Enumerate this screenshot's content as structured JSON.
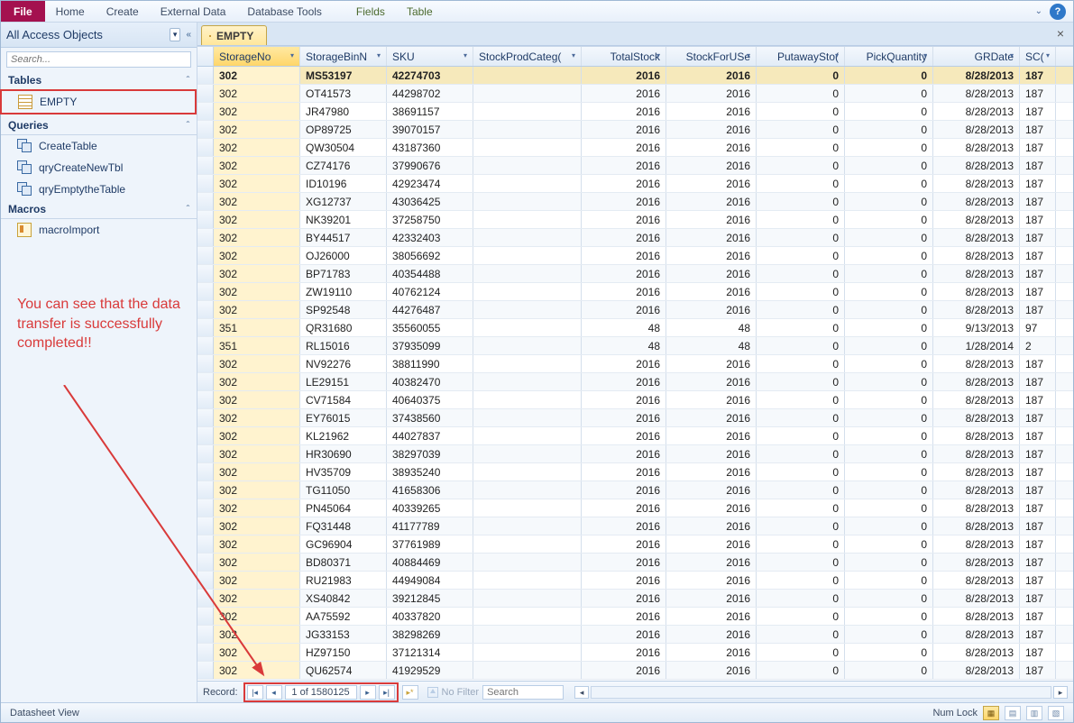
{
  "ribbon": {
    "file": "File",
    "tabs": [
      "Home",
      "Create",
      "External Data",
      "Database Tools"
    ],
    "ctx_tabs": [
      "Fields",
      "Table"
    ]
  },
  "nav": {
    "title": "All Access Objects",
    "search_placeholder": "Search...",
    "groups": [
      {
        "name": "Tables",
        "items": [
          {
            "label": "EMPTY",
            "icon": "table",
            "highlighted": true
          }
        ]
      },
      {
        "name": "Queries",
        "items": [
          {
            "label": "CreateTable",
            "icon": "query"
          },
          {
            "label": "qryCreateNewTbl",
            "icon": "query"
          },
          {
            "label": "qryEmptytheTable",
            "icon": "query"
          }
        ]
      },
      {
        "name": "Macros",
        "items": [
          {
            "label": "macroImport",
            "icon": "macro"
          }
        ]
      }
    ]
  },
  "annotation": {
    "text": "You can see that the data transfer is successfully completed!!"
  },
  "doc_tab": {
    "label": "EMPTY"
  },
  "columns": [
    {
      "key": "StorageNo",
      "label": "StorageNo",
      "cls": "c-sn",
      "sel": true
    },
    {
      "key": "StorageBinN",
      "label": "StorageBinN",
      "cls": "c-bin"
    },
    {
      "key": "SKU",
      "label": "SKU",
      "cls": "c-sku"
    },
    {
      "key": "StockProdCateg",
      "label": "StockProdCateg(",
      "cls": "c-cat"
    },
    {
      "key": "TotalStock",
      "label": "TotalStock",
      "cls": "c-ts",
      "num": true
    },
    {
      "key": "StockForUSe",
      "label": "StockForUSe",
      "cls": "c-fu",
      "num": true
    },
    {
      "key": "PutawayStock",
      "label": "PutawaySto(",
      "cls": "c-pa",
      "num": true
    },
    {
      "key": "PickQuantity",
      "label": "PickQuantity",
      "cls": "c-pq",
      "num": true
    },
    {
      "key": "GRDate",
      "label": "GRDate",
      "cls": "c-gr",
      "num": true
    },
    {
      "key": "SC",
      "label": "SC(",
      "cls": "c-sc"
    }
  ],
  "rows": [
    {
      "StorageNo": "302",
      "StorageBinN": "MS53197",
      "SKU": "42274703",
      "StockProdCateg": "",
      "TotalStock": "2016",
      "StockForUSe": "2016",
      "PutawayStock": "0",
      "PickQuantity": "0",
      "GRDate": "8/28/2013",
      "SC": "187",
      "sel": true
    },
    {
      "StorageNo": "302",
      "StorageBinN": "OT41573",
      "SKU": "44298702",
      "StockProdCateg": "",
      "TotalStock": "2016",
      "StockForUSe": "2016",
      "PutawayStock": "0",
      "PickQuantity": "0",
      "GRDate": "8/28/2013",
      "SC": "187"
    },
    {
      "StorageNo": "302",
      "StorageBinN": "JR47980",
      "SKU": "38691157",
      "StockProdCateg": "",
      "TotalStock": "2016",
      "StockForUSe": "2016",
      "PutawayStock": "0",
      "PickQuantity": "0",
      "GRDate": "8/28/2013",
      "SC": "187"
    },
    {
      "StorageNo": "302",
      "StorageBinN": "OP89725",
      "SKU": "39070157",
      "StockProdCateg": "",
      "TotalStock": "2016",
      "StockForUSe": "2016",
      "PutawayStock": "0",
      "PickQuantity": "0",
      "GRDate": "8/28/2013",
      "SC": "187"
    },
    {
      "StorageNo": "302",
      "StorageBinN": "QW30504",
      "SKU": "43187360",
      "StockProdCateg": "",
      "TotalStock": "2016",
      "StockForUSe": "2016",
      "PutawayStock": "0",
      "PickQuantity": "0",
      "GRDate": "8/28/2013",
      "SC": "187"
    },
    {
      "StorageNo": "302",
      "StorageBinN": "CZ74176",
      "SKU": "37990676",
      "StockProdCateg": "",
      "TotalStock": "2016",
      "StockForUSe": "2016",
      "PutawayStock": "0",
      "PickQuantity": "0",
      "GRDate": "8/28/2013",
      "SC": "187"
    },
    {
      "StorageNo": "302",
      "StorageBinN": "ID10196",
      "SKU": "42923474",
      "StockProdCateg": "",
      "TotalStock": "2016",
      "StockForUSe": "2016",
      "PutawayStock": "0",
      "PickQuantity": "0",
      "GRDate": "8/28/2013",
      "SC": "187"
    },
    {
      "StorageNo": "302",
      "StorageBinN": "XG12737",
      "SKU": "43036425",
      "StockProdCateg": "",
      "TotalStock": "2016",
      "StockForUSe": "2016",
      "PutawayStock": "0",
      "PickQuantity": "0",
      "GRDate": "8/28/2013",
      "SC": "187"
    },
    {
      "StorageNo": "302",
      "StorageBinN": "NK39201",
      "SKU": "37258750",
      "StockProdCateg": "",
      "TotalStock": "2016",
      "StockForUSe": "2016",
      "PutawayStock": "0",
      "PickQuantity": "0",
      "GRDate": "8/28/2013",
      "SC": "187"
    },
    {
      "StorageNo": "302",
      "StorageBinN": "BY44517",
      "SKU": "42332403",
      "StockProdCateg": "",
      "TotalStock": "2016",
      "StockForUSe": "2016",
      "PutawayStock": "0",
      "PickQuantity": "0",
      "GRDate": "8/28/2013",
      "SC": "187"
    },
    {
      "StorageNo": "302",
      "StorageBinN": "OJ26000",
      "SKU": "38056692",
      "StockProdCateg": "",
      "TotalStock": "2016",
      "StockForUSe": "2016",
      "PutawayStock": "0",
      "PickQuantity": "0",
      "GRDate": "8/28/2013",
      "SC": "187"
    },
    {
      "StorageNo": "302",
      "StorageBinN": "BP71783",
      "SKU": "40354488",
      "StockProdCateg": "",
      "TotalStock": "2016",
      "StockForUSe": "2016",
      "PutawayStock": "0",
      "PickQuantity": "0",
      "GRDate": "8/28/2013",
      "SC": "187"
    },
    {
      "StorageNo": "302",
      "StorageBinN": "ZW19110",
      "SKU": "40762124",
      "StockProdCateg": "",
      "TotalStock": "2016",
      "StockForUSe": "2016",
      "PutawayStock": "0",
      "PickQuantity": "0",
      "GRDate": "8/28/2013",
      "SC": "187"
    },
    {
      "StorageNo": "302",
      "StorageBinN": "SP92548",
      "SKU": "44276487",
      "StockProdCateg": "",
      "TotalStock": "2016",
      "StockForUSe": "2016",
      "PutawayStock": "0",
      "PickQuantity": "0",
      "GRDate": "8/28/2013",
      "SC": "187"
    },
    {
      "StorageNo": "351",
      "StorageBinN": "QR31680",
      "SKU": "35560055",
      "StockProdCateg": "",
      "TotalStock": "48",
      "StockForUSe": "48",
      "PutawayStock": "0",
      "PickQuantity": "0",
      "GRDate": "9/13/2013",
      "SC": "97"
    },
    {
      "StorageNo": "351",
      "StorageBinN": "RL15016",
      "SKU": "37935099",
      "StockProdCateg": "",
      "TotalStock": "48",
      "StockForUSe": "48",
      "PutawayStock": "0",
      "PickQuantity": "0",
      "GRDate": "1/28/2014",
      "SC": "2"
    },
    {
      "StorageNo": "302",
      "StorageBinN": "NV92276",
      "SKU": "38811990",
      "StockProdCateg": "",
      "TotalStock": "2016",
      "StockForUSe": "2016",
      "PutawayStock": "0",
      "PickQuantity": "0",
      "GRDate": "8/28/2013",
      "SC": "187"
    },
    {
      "StorageNo": "302",
      "StorageBinN": "LE29151",
      "SKU": "40382470",
      "StockProdCateg": "",
      "TotalStock": "2016",
      "StockForUSe": "2016",
      "PutawayStock": "0",
      "PickQuantity": "0",
      "GRDate": "8/28/2013",
      "SC": "187"
    },
    {
      "StorageNo": "302",
      "StorageBinN": "CV71584",
      "SKU": "40640375",
      "StockProdCateg": "",
      "TotalStock": "2016",
      "StockForUSe": "2016",
      "PutawayStock": "0",
      "PickQuantity": "0",
      "GRDate": "8/28/2013",
      "SC": "187"
    },
    {
      "StorageNo": "302",
      "StorageBinN": "EY76015",
      "SKU": "37438560",
      "StockProdCateg": "",
      "TotalStock": "2016",
      "StockForUSe": "2016",
      "PutawayStock": "0",
      "PickQuantity": "0",
      "GRDate": "8/28/2013",
      "SC": "187"
    },
    {
      "StorageNo": "302",
      "StorageBinN": "KL21962",
      "SKU": "44027837",
      "StockProdCateg": "",
      "TotalStock": "2016",
      "StockForUSe": "2016",
      "PutawayStock": "0",
      "PickQuantity": "0",
      "GRDate": "8/28/2013",
      "SC": "187"
    },
    {
      "StorageNo": "302",
      "StorageBinN": "HR30690",
      "SKU": "38297039",
      "StockProdCateg": "",
      "TotalStock": "2016",
      "StockForUSe": "2016",
      "PutawayStock": "0",
      "PickQuantity": "0",
      "GRDate": "8/28/2013",
      "SC": "187"
    },
    {
      "StorageNo": "302",
      "StorageBinN": "HV35709",
      "SKU": "38935240",
      "StockProdCateg": "",
      "TotalStock": "2016",
      "StockForUSe": "2016",
      "PutawayStock": "0",
      "PickQuantity": "0",
      "GRDate": "8/28/2013",
      "SC": "187"
    },
    {
      "StorageNo": "302",
      "StorageBinN": "TG11050",
      "SKU": "41658306",
      "StockProdCateg": "",
      "TotalStock": "2016",
      "StockForUSe": "2016",
      "PutawayStock": "0",
      "PickQuantity": "0",
      "GRDate": "8/28/2013",
      "SC": "187"
    },
    {
      "StorageNo": "302",
      "StorageBinN": "PN45064",
      "SKU": "40339265",
      "StockProdCateg": "",
      "TotalStock": "2016",
      "StockForUSe": "2016",
      "PutawayStock": "0",
      "PickQuantity": "0",
      "GRDate": "8/28/2013",
      "SC": "187"
    },
    {
      "StorageNo": "302",
      "StorageBinN": "FQ31448",
      "SKU": "41177789",
      "StockProdCateg": "",
      "TotalStock": "2016",
      "StockForUSe": "2016",
      "PutawayStock": "0",
      "PickQuantity": "0",
      "GRDate": "8/28/2013",
      "SC": "187"
    },
    {
      "StorageNo": "302",
      "StorageBinN": "GC96904",
      "SKU": "37761989",
      "StockProdCateg": "",
      "TotalStock": "2016",
      "StockForUSe": "2016",
      "PutawayStock": "0",
      "PickQuantity": "0",
      "GRDate": "8/28/2013",
      "SC": "187"
    },
    {
      "StorageNo": "302",
      "StorageBinN": "BD80371",
      "SKU": "40884469",
      "StockProdCateg": "",
      "TotalStock": "2016",
      "StockForUSe": "2016",
      "PutawayStock": "0",
      "PickQuantity": "0",
      "GRDate": "8/28/2013",
      "SC": "187"
    },
    {
      "StorageNo": "302",
      "StorageBinN": "RU21983",
      "SKU": "44949084",
      "StockProdCateg": "",
      "TotalStock": "2016",
      "StockForUSe": "2016",
      "PutawayStock": "0",
      "PickQuantity": "0",
      "GRDate": "8/28/2013",
      "SC": "187"
    },
    {
      "StorageNo": "302",
      "StorageBinN": "XS40842",
      "SKU": "39212845",
      "StockProdCateg": "",
      "TotalStock": "2016",
      "StockForUSe": "2016",
      "PutawayStock": "0",
      "PickQuantity": "0",
      "GRDate": "8/28/2013",
      "SC": "187"
    },
    {
      "StorageNo": "302",
      "StorageBinN": "AA75592",
      "SKU": "40337820",
      "StockProdCateg": "",
      "TotalStock": "2016",
      "StockForUSe": "2016",
      "PutawayStock": "0",
      "PickQuantity": "0",
      "GRDate": "8/28/2013",
      "SC": "187"
    },
    {
      "StorageNo": "302",
      "StorageBinN": "JG33153",
      "SKU": "38298269",
      "StockProdCateg": "",
      "TotalStock": "2016",
      "StockForUSe": "2016",
      "PutawayStock": "0",
      "PickQuantity": "0",
      "GRDate": "8/28/2013",
      "SC": "187"
    },
    {
      "StorageNo": "302",
      "StorageBinN": "HZ97150",
      "SKU": "37121314",
      "StockProdCateg": "",
      "TotalStock": "2016",
      "StockForUSe": "2016",
      "PutawayStock": "0",
      "PickQuantity": "0",
      "GRDate": "8/28/2013",
      "SC": "187"
    },
    {
      "StorageNo": "302",
      "StorageBinN": "QU62574",
      "SKU": "41929529",
      "StockProdCateg": "",
      "TotalStock": "2016",
      "StockForUSe": "2016",
      "PutawayStock": "0",
      "PickQuantity": "0",
      "GRDate": "8/28/2013",
      "SC": "187"
    }
  ],
  "recordbar": {
    "label": "Record:",
    "position": "1 of 1580125",
    "filter_label": "No Filter",
    "search_placeholder": "Search"
  },
  "statusbar": {
    "view": "Datasheet View",
    "numlock": "Num Lock"
  }
}
